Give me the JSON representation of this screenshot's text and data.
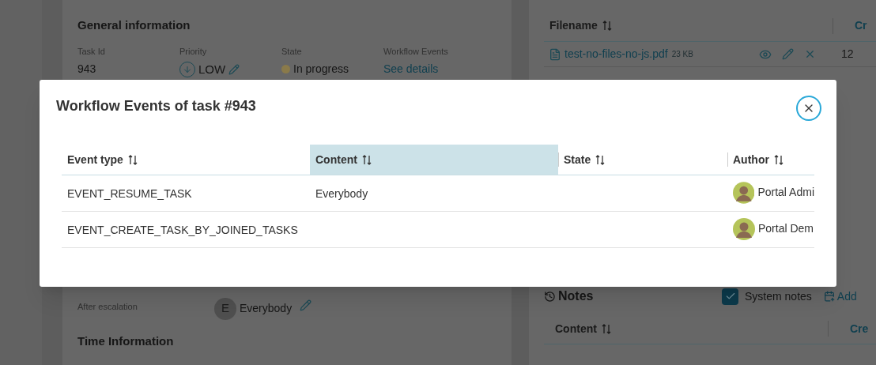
{
  "general_information": {
    "title": "General information",
    "fields": [
      {
        "kind": "text",
        "label": "Task Id",
        "value": "943"
      },
      {
        "kind": "priority",
        "label": "Priority",
        "value": "LOW"
      },
      {
        "kind": "state",
        "label": "State",
        "value": "In progress",
        "color": "#8a7a4a"
      },
      {
        "kind": "link",
        "label": "Workflow Events",
        "value": "See details"
      }
    ]
  },
  "documents": {
    "columns": [
      {
        "label": "Filename",
        "sortable": true
      },
      {
        "label": "Cr",
        "sortable": false
      }
    ],
    "rows": [
      {
        "filename": "test-no-files-no-js.pdf",
        "size": "23 KB",
        "column_2": "12"
      }
    ]
  },
  "escalation": {
    "label": "After escalation",
    "initial": "E",
    "value": "Everybody"
  },
  "time_information": {
    "title": "Time Information"
  },
  "notes": {
    "title": "Notes",
    "system_notes": {
      "label": "System notes",
      "checked": true
    },
    "add_link": "Add",
    "columns": [
      {
        "label": "Content",
        "sortable": true
      },
      {
        "label": "Cre",
        "sortable": false
      }
    ]
  },
  "dialog": {
    "title": "Workflow Events of task #943",
    "columns": [
      {
        "label": "Event type",
        "selected": false
      },
      {
        "label": "Content",
        "selected": true
      },
      {
        "label": "State",
        "selected": false
      },
      {
        "label": "Author",
        "selected": false
      }
    ],
    "rows": [
      {
        "event_type": "EVENT_RESUME_TASK",
        "content": "Everybody",
        "state": "",
        "author": "Portal Admi"
      },
      {
        "event_type": "EVENT_CREATE_TASK_BY_JOINED_TASKS",
        "content": "",
        "state": "",
        "author": "Portal Dem"
      }
    ]
  }
}
